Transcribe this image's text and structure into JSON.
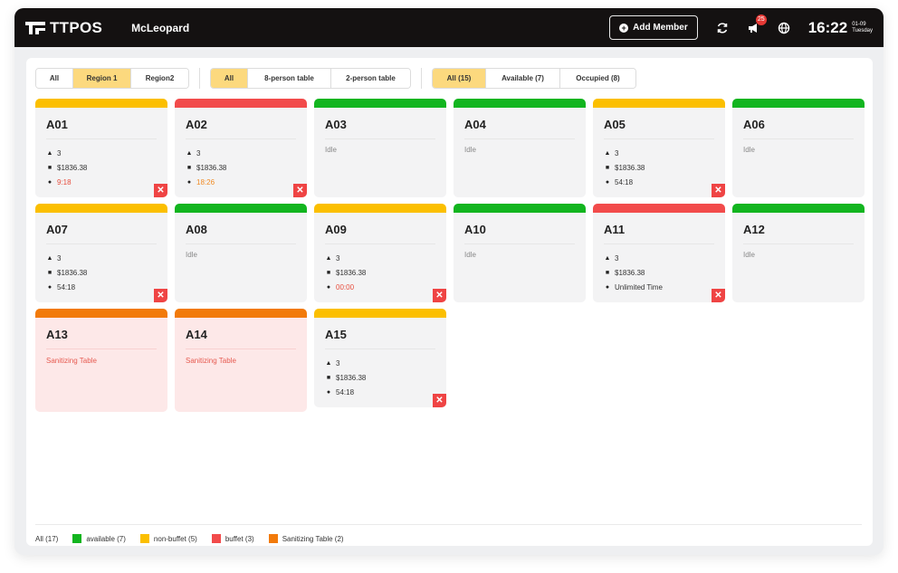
{
  "header": {
    "brand": "TTPOS",
    "store": "McLeopard",
    "add_member_label": "Add Member",
    "notification_count": "25",
    "time": "16:22",
    "date": "01-09",
    "weekday": "Tuesday"
  },
  "filters": {
    "region": [
      "All",
      "Region 1",
      "Region2"
    ],
    "table_type": [
      "All",
      "8-person table",
      "2-person table"
    ],
    "status": [
      "All (15)",
      "Available (7)",
      "Occupied (8)"
    ]
  },
  "colors": {
    "available": "#12b51f",
    "non_buffet": "#fbbf00",
    "buffet": "#f24b4b",
    "sanitizing": "#f27a0a",
    "active_filter": "#fcd97e"
  },
  "tables": [
    {
      "name": "A01",
      "status": "non_buffet",
      "guests": "3",
      "amount": "$1836.38",
      "time": "9:18",
      "time_style": "red",
      "closable": true
    },
    {
      "name": "A02",
      "status": "buffet",
      "guests": "3",
      "amount": "$1836.38",
      "time": "18:26",
      "time_style": "orange",
      "closable": true
    },
    {
      "name": "A03",
      "status": "available",
      "idle": "Idle"
    },
    {
      "name": "A04",
      "status": "available",
      "idle": "Idle"
    },
    {
      "name": "A05",
      "status": "non_buffet",
      "guests": "3",
      "amount": "$1836.38",
      "time": "54:18",
      "time_style": "normal",
      "closable": true
    },
    {
      "name": "A06",
      "status": "available",
      "idle": "Idle"
    },
    {
      "name": "A07",
      "status": "non_buffet",
      "guests": "3",
      "amount": "$1836.38",
      "time": "54:18",
      "time_style": "normal",
      "closable": true
    },
    {
      "name": "A08",
      "status": "available",
      "idle": "Idle"
    },
    {
      "name": "A09",
      "status": "non_buffet",
      "guests": "3",
      "amount": "$1836.38",
      "time": "00:00",
      "time_style": "red",
      "closable": true
    },
    {
      "name": "A10",
      "status": "available",
      "idle": "Idle"
    },
    {
      "name": "A11",
      "status": "buffet",
      "guests": "3",
      "amount": "$1836.38",
      "time": "Unlimited Time",
      "time_style": "normal",
      "closable": true
    },
    {
      "name": "A12",
      "status": "available",
      "idle": "Idle"
    },
    {
      "name": "A13",
      "status": "sanitizing",
      "sanitizing_text": "Sanitizing Table"
    },
    {
      "name": "A14",
      "status": "sanitizing",
      "sanitizing_text": "Sanitizing Table"
    },
    {
      "name": "A15",
      "status": "non_buffet",
      "guests": "3",
      "amount": "$1836.38",
      "time": "54:18",
      "time_style": "normal",
      "closable": true
    }
  ],
  "legend": {
    "all": "All (17)",
    "items": [
      {
        "label": "available (7)",
        "status": "available"
      },
      {
        "label": "non-buffet (5)",
        "status": "non_buffet"
      },
      {
        "label": "buffet (3)",
        "status": "buffet"
      },
      {
        "label": "Sanitizing Table (2)",
        "status": "sanitizing"
      }
    ]
  },
  "icons": {
    "guests": "person-icon",
    "amount": "bag-icon",
    "time": "clock-icon",
    "close": "close-icon",
    "refresh": "refresh-icon",
    "notification": "megaphone-icon",
    "language": "globe-icon"
  }
}
